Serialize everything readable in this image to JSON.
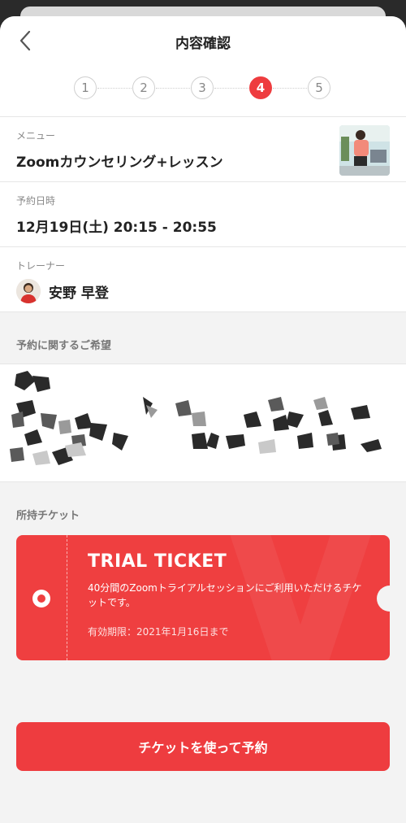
{
  "header": {
    "title": "内容確認"
  },
  "steps": [
    {
      "label": "1",
      "active": false
    },
    {
      "label": "2",
      "active": false
    },
    {
      "label": "3",
      "active": false
    },
    {
      "label": "4",
      "active": true
    },
    {
      "label": "5",
      "active": false
    }
  ],
  "details": {
    "menu_label": "メニュー",
    "menu_value": "Zoomカウンセリング+レッスン",
    "date_label": "予約日時",
    "date_value": "12月19日(土) 20:15 - 20:55",
    "trainer_label": "トレーナー",
    "trainer_name": "安野 早登"
  },
  "request": {
    "title": "予約に関するご希望"
  },
  "tickets": {
    "title": "所持チケット",
    "name": "TRIAL TICKET",
    "description": "40分間のZoomトライアルセッションにご利用いただけるチケットです。",
    "expiry": "有効期限：2021年1月16日まで",
    "selected": true
  },
  "cta": {
    "label": "チケットを使って予約"
  },
  "colors": {
    "accent": "#ee3c3f",
    "background": "#f3f3f3"
  },
  "icons": {
    "back": "chevron-left-icon"
  }
}
